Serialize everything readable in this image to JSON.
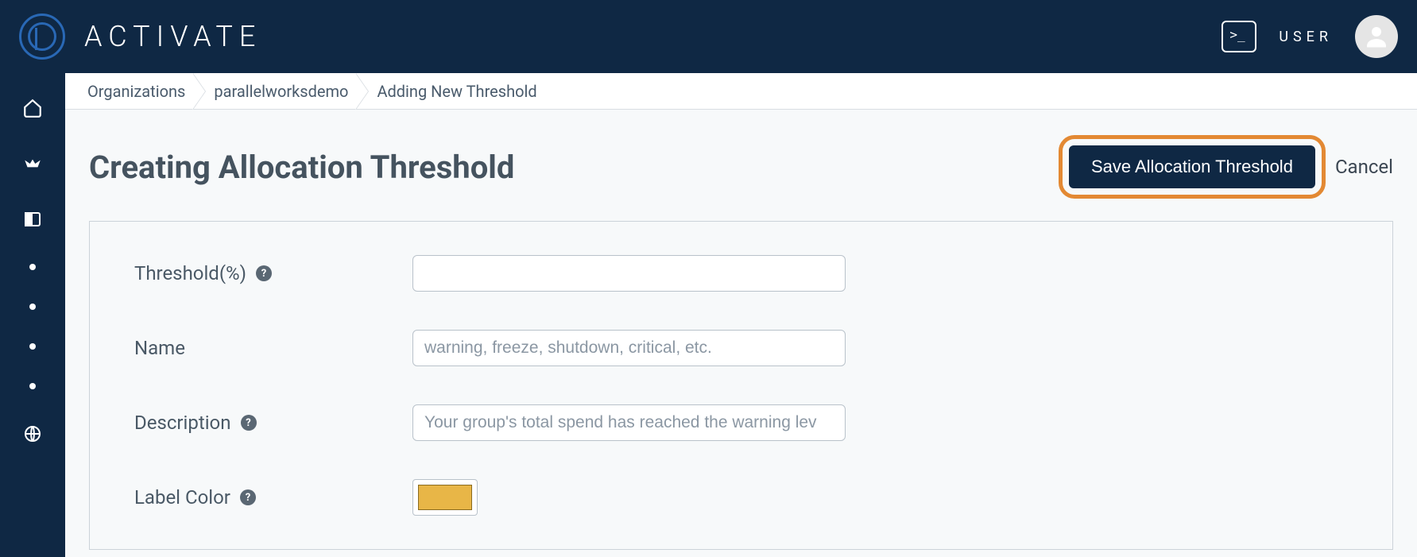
{
  "header": {
    "brand": "ACTIVATE",
    "user_label": "USER"
  },
  "breadcrumb": {
    "items": [
      "Organizations",
      "parallelworksdemo",
      "Adding New Threshold"
    ]
  },
  "page": {
    "title": "Creating Allocation Threshold",
    "save_label": "Save Allocation Threshold",
    "cancel_label": "Cancel"
  },
  "form": {
    "threshold": {
      "label": "Threshold(%)",
      "value": ""
    },
    "name": {
      "label": "Name",
      "placeholder": "warning, freeze, shutdown, critical, etc.",
      "value": ""
    },
    "description": {
      "label": "Description",
      "placeholder": "Your group's total spend has reached the warning lev",
      "value": ""
    },
    "label_color": {
      "label": "Label Color",
      "value": "#e8b647"
    }
  }
}
